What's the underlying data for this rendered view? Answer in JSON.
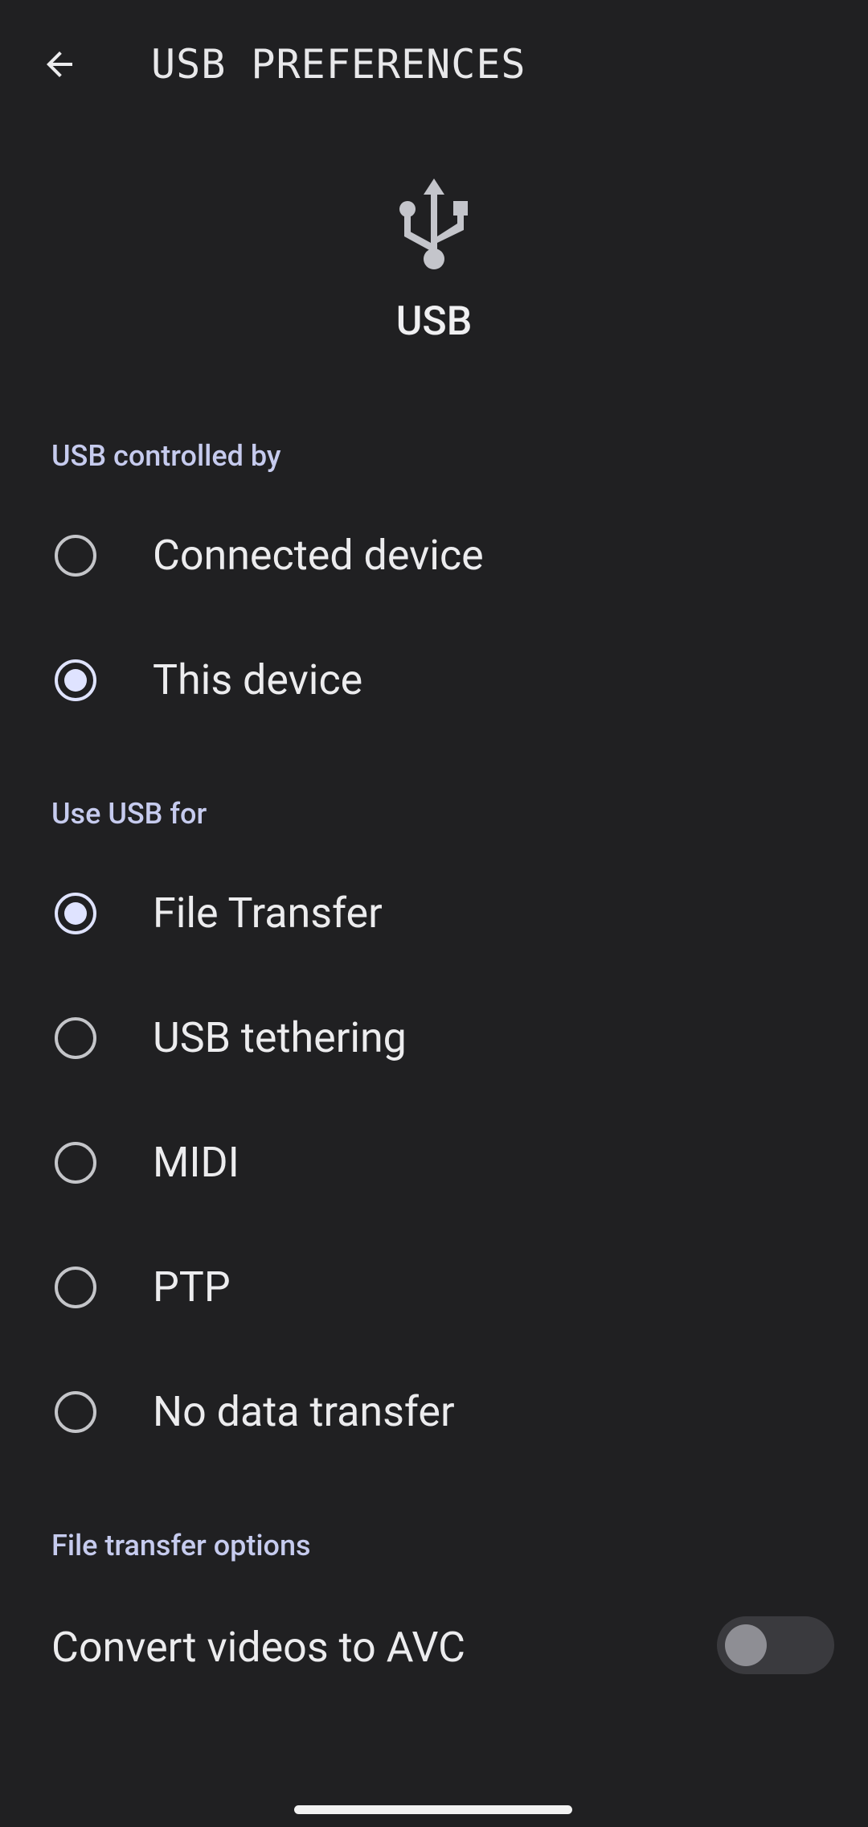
{
  "app_bar": {
    "title": "USB PREFERENCES",
    "back_icon": "arrow-back-icon"
  },
  "header": {
    "icon": "usb-icon",
    "title": "USB"
  },
  "sections": {
    "controlled_by": {
      "label": "USB controlled by",
      "options": [
        {
          "label": "Connected device",
          "selected": false
        },
        {
          "label": "This device",
          "selected": true
        }
      ]
    },
    "use_usb_for": {
      "label": "Use USB for",
      "options": [
        {
          "label": "File Transfer",
          "selected": true
        },
        {
          "label": "USB tethering",
          "selected": false
        },
        {
          "label": "MIDI",
          "selected": false
        },
        {
          "label": "PTP",
          "selected": false
        },
        {
          "label": "No data transfer",
          "selected": false
        }
      ]
    },
    "file_transfer_options": {
      "label": "File transfer options",
      "convert_videos": {
        "label": "Convert videos to AVC",
        "enabled": false
      }
    }
  },
  "colors": {
    "background": "#202022",
    "accent": "#c6cbee",
    "radio_checked": "#dfe3ff",
    "text_primary": "#ececee"
  }
}
